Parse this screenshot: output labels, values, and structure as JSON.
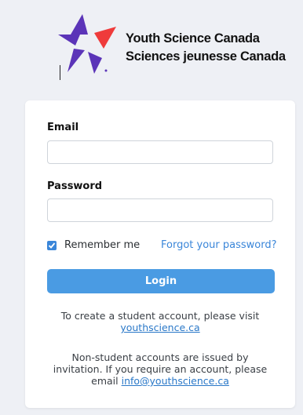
{
  "brand": {
    "name_en": "Youth Science Canada",
    "name_fr": "Sciences jeunesse Canada",
    "logo_icon": "star-logo-icon",
    "colors": {
      "purple": "#5b34b8",
      "red": "#ef3b3b"
    }
  },
  "form": {
    "email_label": "Email",
    "email_value": "",
    "password_label": "Password",
    "password_value": "",
    "remember_label": "Remember me",
    "remember_checked": true,
    "forgot_link": "Forgot your password?",
    "login_button": "Login"
  },
  "info": {
    "student_text": "To create a student account, please visit",
    "student_link": "youthscience.ca",
    "nonstudent_text": "Non-student accounts are issued by invitation. If you require an account, please email",
    "nonstudent_link": "info@youthscience.ca"
  },
  "colors": {
    "accent": "#4a9be3",
    "link": "#3a86d9",
    "background": "#eef0f5"
  }
}
